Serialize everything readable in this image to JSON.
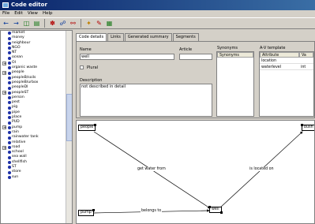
{
  "window": {
    "title": "Code editor"
  },
  "menu": [
    "File",
    "Edit",
    "View",
    "Help"
  ],
  "toolbar": {
    "icons": [
      "arrow-left-icon",
      "arrow-right-icon",
      "hierarchy-icon",
      "tree-icon",
      "code-icon",
      "network-icon",
      "link-icon",
      "filter-icon",
      "report-icon"
    ]
  },
  "tree": {
    "items": [
      {
        "label": "market",
        "exp": ""
      },
      {
        "label": "money",
        "exp": ""
      },
      {
        "label": "neighbour",
        "exp": ""
      },
      {
        "label": "NGO",
        "exp": ""
      },
      {
        "label": "NT",
        "exp": ""
      },
      {
        "label": "ocean",
        "exp": ""
      },
      {
        "label": "OI",
        "exp": "+"
      },
      {
        "label": "organic waste",
        "exp": ""
      },
      {
        "label": "people",
        "exp": "+"
      },
      {
        "label": "peopleB/soils",
        "exp": ""
      },
      {
        "label": "peopleB/urbox",
        "exp": ""
      },
      {
        "label": "peopleDI",
        "exp": ""
      },
      {
        "label": "peopleST",
        "exp": "+"
      },
      {
        "label": "person",
        "exp": ""
      },
      {
        "label": "pest",
        "exp": ""
      },
      {
        "label": "pig",
        "exp": ""
      },
      {
        "label": "pipe",
        "exp": ""
      },
      {
        "label": "place",
        "exp": ""
      },
      {
        "label": "PUD",
        "exp": ""
      },
      {
        "label": "pump",
        "exp": "+"
      },
      {
        "label": "rain",
        "exp": ""
      },
      {
        "label": "rainwater tank",
        "exp": ""
      },
      {
        "label": "relative",
        "exp": ""
      },
      {
        "label": "road",
        "exp": "+"
      },
      {
        "label": "school",
        "exp": ""
      },
      {
        "label": "sea wall",
        "exp": ""
      },
      {
        "label": "shellfish",
        "exp": ""
      },
      {
        "label": "ST",
        "exp": ""
      },
      {
        "label": "store",
        "exp": ""
      },
      {
        "label": "sun",
        "exp": ""
      }
    ]
  },
  "tabs": [
    "Code details",
    "Links",
    "Generated summary",
    "Segments"
  ],
  "details": {
    "name_label": "Name",
    "name_value": "well",
    "article_label": "Article",
    "article_value": "",
    "plural_label": "Plural",
    "description_label": "Description",
    "description_value": "not described in detail"
  },
  "synonyms": {
    "title": "Synonyms",
    "column": "Synonyms"
  },
  "av_template": {
    "title": "A-V template",
    "columns": [
      "Attribute",
      "Va"
    ],
    "rows": [
      {
        "attr": "location",
        "val": ""
      },
      {
        "attr": "waterlevel",
        "val": "int"
      }
    ]
  },
  "diagram": {
    "nodes": {
      "people": "people",
      "well": "well",
      "pump": "pump",
      "bush": "bush"
    },
    "edges": {
      "get_water": "get water from",
      "located": "is located on",
      "belongs": "belongs to"
    }
  }
}
